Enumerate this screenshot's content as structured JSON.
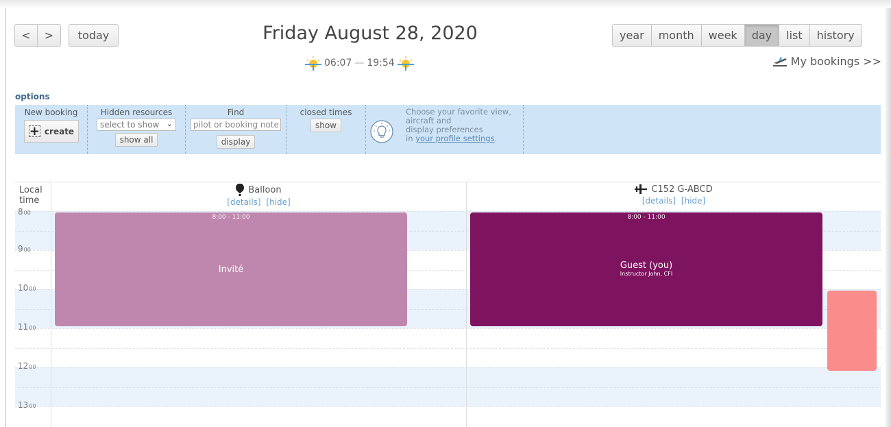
{
  "nav": {
    "prev": "<",
    "next": ">",
    "today": "today"
  },
  "title": "Friday August 28, 2020",
  "sun": {
    "rise": "06:07",
    "dash": "—",
    "set": "19:54"
  },
  "views": [
    "year",
    "month",
    "week",
    "day",
    "list",
    "history"
  ],
  "active_view": "day",
  "my_bookings": "My bookings >>",
  "options": {
    "link": "options",
    "new_booking": {
      "label": "New booking",
      "button": "create"
    },
    "hidden_resources": {
      "label": "Hidden resources",
      "select_value": "select to show",
      "button": "show all"
    },
    "find": {
      "label": "Find",
      "placeholder": "pilot or booking note",
      "button": "display"
    },
    "closed_times": {
      "label": "closed times",
      "button": "show"
    },
    "tip": {
      "line1": "Choose your favorite view,",
      "line2": "aircraft and",
      "line3": "display preferences",
      "line4_prefix": "in ",
      "line4_link": "your profile settings",
      "line4_suffix": "."
    }
  },
  "calendar": {
    "local_time_label_1": "Local",
    "local_time_label_2": "time",
    "resources": [
      {
        "name": "Balloon",
        "details": "[details]",
        "hide": "[hide]"
      },
      {
        "name": "C152 G-ABCD",
        "details": "[details]",
        "hide": "[hide]"
      }
    ],
    "hours": [
      {
        "h": "8",
        "m": "00"
      },
      {
        "h": "9",
        "m": "00"
      },
      {
        "h": "10",
        "m": "00"
      },
      {
        "h": "11",
        "m": "00"
      },
      {
        "h": "12",
        "m": "00"
      },
      {
        "h": "13",
        "m": "00"
      }
    ],
    "events": [
      {
        "time": "8:00 - 11:00",
        "who": "Invité",
        "sub": "",
        "color": "#bf87ae"
      },
      {
        "time": "8:00 - 11:00",
        "who": "Guest (you)",
        "sub": "Instructor John, CFI",
        "color": "#7e1460"
      },
      {
        "color": "#fb8c8c"
      }
    ]
  },
  "colors": {
    "options_bg": "#cfe5f7",
    "slot_blue": "#eaf3fc",
    "link_blue": "#6aa0d0"
  }
}
